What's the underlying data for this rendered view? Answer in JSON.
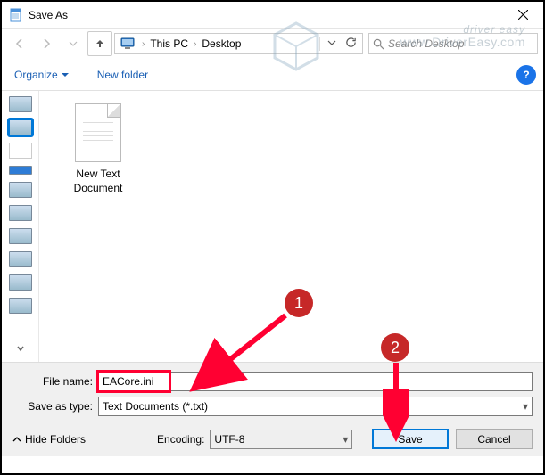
{
  "window": {
    "title": "Save As"
  },
  "nav": {
    "crumb_root": "This PC",
    "crumb_leaf": "Desktop",
    "search_placeholder": "Search Desktop"
  },
  "toolbar": {
    "organize_label": "Organize",
    "newfolder_label": "New folder",
    "help_symbol": "?"
  },
  "filepane": {
    "items": [
      {
        "label_line1": "New Text",
        "label_line2": "Document"
      }
    ]
  },
  "form": {
    "filename_label": "File name:",
    "filename_value": "EACore.ini",
    "savetype_label": "Save as type:",
    "savetype_value": "Text Documents (*.txt)",
    "hidefolders_label": "Hide Folders",
    "encoding_label": "Encoding:",
    "encoding_value": "UTF-8",
    "save_label": "Save",
    "cancel_label": "Cancel"
  },
  "annotations": {
    "step1": "1",
    "step2": "2"
  },
  "watermark": {
    "main": "driver easy",
    "sub": "www.DriverEasy.com"
  }
}
